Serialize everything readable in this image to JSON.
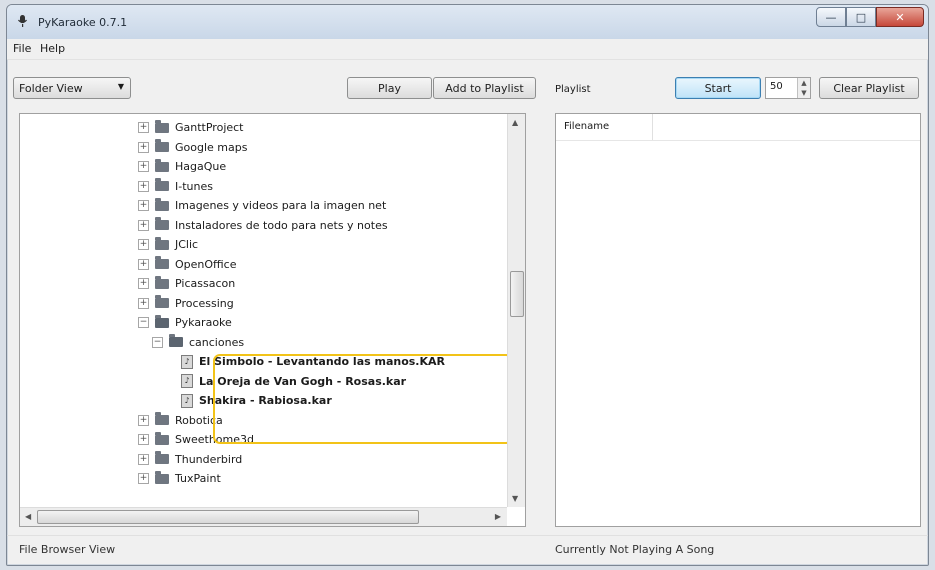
{
  "window": {
    "title": "PyKaraoke 0.7.1"
  },
  "menu": [
    "File",
    "Help"
  ],
  "left": {
    "view_select": "Folder View",
    "play_label": "Play",
    "add_label": "Add to Playlist"
  },
  "tree": [
    {
      "label": "GanttProject",
      "level": 0,
      "type": "folder",
      "expander": "+"
    },
    {
      "label": "Google maps",
      "level": 0,
      "type": "folder",
      "expander": "+"
    },
    {
      "label": "HagaQue",
      "level": 0,
      "type": "folder",
      "expander": "+"
    },
    {
      "label": "I-tunes",
      "level": 0,
      "type": "folder",
      "expander": "+"
    },
    {
      "label": "Imagenes y videos para la imagen net",
      "level": 0,
      "type": "folder",
      "expander": "+"
    },
    {
      "label": "Instaladores de todo para nets y notes",
      "level": 0,
      "type": "folder",
      "expander": "+"
    },
    {
      "label": "JClic",
      "level": 0,
      "type": "folder",
      "expander": "+"
    },
    {
      "label": "OpenOffice",
      "level": 0,
      "type": "folder",
      "expander": "+"
    },
    {
      "label": "Picassacon",
      "level": 0,
      "type": "folder",
      "expander": "+"
    },
    {
      "label": "Processing",
      "level": 0,
      "type": "folder",
      "expander": "+"
    },
    {
      "label": "Pykaraoke",
      "level": 0,
      "type": "folder-open",
      "expander": "−"
    },
    {
      "label": "canciones",
      "level": 1,
      "type": "folder-open",
      "expander": "−"
    },
    {
      "label": "El Simbolo - Levantando las manos.KAR",
      "level": 2,
      "type": "file"
    },
    {
      "label": "La Oreja de Van Gogh - Rosas.kar",
      "level": 2,
      "type": "file"
    },
    {
      "label": "Shakira - Rabiosa.kar",
      "level": 2,
      "type": "file"
    },
    {
      "label": "Robotica",
      "level": 0,
      "type": "folder",
      "expander": "+"
    },
    {
      "label": "Sweethome3d",
      "level": 0,
      "type": "folder",
      "expander": "+"
    },
    {
      "label": "Thunderbird",
      "level": 0,
      "type": "folder",
      "expander": "+"
    },
    {
      "label": "TuxPaint",
      "level": 0,
      "type": "folder",
      "expander": "+"
    }
  ],
  "right": {
    "playlist_label": "Playlist",
    "start_label": "Start",
    "spin_value": "50",
    "clear_label": "Clear Playlist",
    "column_filename": "Filename"
  },
  "status": {
    "left": "File Browser View",
    "right": "Currently Not Playing A Song"
  }
}
